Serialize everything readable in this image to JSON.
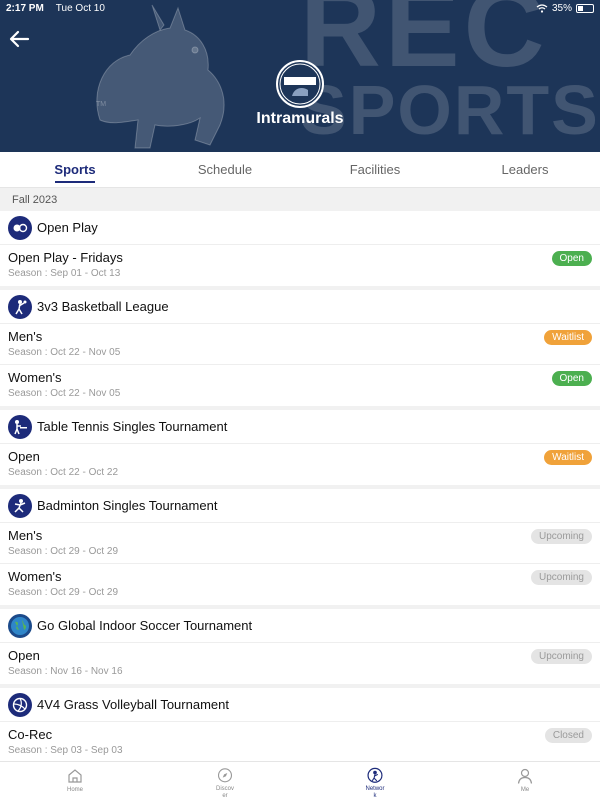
{
  "status_bar": {
    "time": "2:17 PM",
    "date": "Tue Oct 10",
    "battery": "35%"
  },
  "header": {
    "watermark_line1": "REC",
    "watermark_line2": "SPORTS",
    "title": "Intramurals",
    "logo_text_top": "MINES",
    "logo_text_bottom": "INTRAMURAL & CLUB SPORTS"
  },
  "tabs": [
    {
      "label": "Sports",
      "active": true
    },
    {
      "label": "Schedule",
      "active": false
    },
    {
      "label": "Facilities",
      "active": false
    },
    {
      "label": "Leaders",
      "active": false
    }
  ],
  "season_label": "Fall 2023",
  "sports": [
    {
      "name": "Open Play",
      "icon": "open-play-icon",
      "entries": [
        {
          "name": "Open Play - Fridays",
          "season": "Season : Sep 01 - Oct 13",
          "status": "Open",
          "status_type": "open"
        }
      ]
    },
    {
      "name": "3v3 Basketball League",
      "icon": "basketball-icon",
      "entries": [
        {
          "name": "Men's",
          "season": "Season : Oct 22 - Nov 05",
          "status": "Waitlist",
          "status_type": "waitlist"
        },
        {
          "name": "Women's",
          "season": "Season : Oct 22 - Nov 05",
          "status": "Open",
          "status_type": "open"
        }
      ]
    },
    {
      "name": "Table Tennis Singles Tournament",
      "icon": "table-tennis-icon",
      "entries": [
        {
          "name": "Open",
          "season": "Season : Oct 22 - Oct 22",
          "status": "Waitlist",
          "status_type": "waitlist"
        }
      ]
    },
    {
      "name": "Badminton Singles Tournament",
      "icon": "badminton-icon",
      "entries": [
        {
          "name": "Men's",
          "season": "Season : Oct 29 - Oct 29",
          "status": "Upcoming",
          "status_type": "upcoming"
        },
        {
          "name": "Women's",
          "season": "Season : Oct 29 - Oct 29",
          "status": "Upcoming",
          "status_type": "upcoming"
        }
      ]
    },
    {
      "name": "Go Global Indoor Soccer Tournament",
      "icon": "globe-icon",
      "entries": [
        {
          "name": "Open",
          "season": "Season : Nov 16 - Nov 16",
          "status": "Upcoming",
          "status_type": "upcoming"
        }
      ]
    },
    {
      "name": "4V4 Grass Volleyball Tournament",
      "icon": "volleyball-icon",
      "entries": [
        {
          "name": "Co-Rec",
          "season": "Season : Sep 03 - Sep 03",
          "status": "Closed",
          "status_type": "closed"
        }
      ]
    }
  ],
  "bottom_nav": [
    {
      "label": "Home",
      "icon": "home-icon",
      "active": false
    },
    {
      "label": "Discover",
      "icon": "compass-icon",
      "active": false
    },
    {
      "label": "Network",
      "icon": "network-icon",
      "active": true
    },
    {
      "label": "Me",
      "icon": "user-icon",
      "active": false
    }
  ]
}
